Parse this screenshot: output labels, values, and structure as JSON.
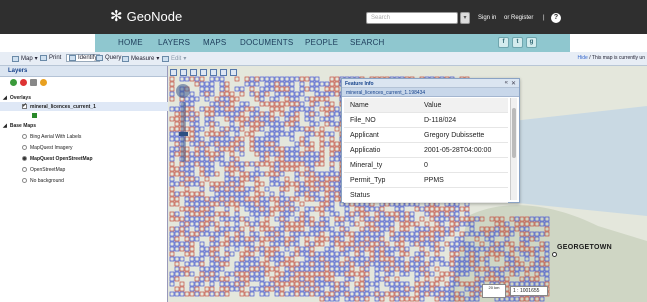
{
  "header": {
    "logo_text": "GeoNode",
    "search_placeholder": "Search",
    "sign_in": "Sign in",
    "register": "or Register",
    "separator": "|",
    "help_glyph": "?"
  },
  "nav": {
    "items": [
      "HOME",
      "LAYERS",
      "MAPS",
      "DOCUMENTS",
      "PEOPLE",
      "SEARCH"
    ],
    "social": [
      "f",
      "t",
      "g"
    ]
  },
  "toolbar": {
    "map": "Map",
    "print": "Print",
    "identify": "Identify",
    "query": "Query",
    "measure": "Measure",
    "edit": "Edit",
    "notice_link": "Hide",
    "notice_text": "This map is currently un"
  },
  "layers_panel": {
    "title": "Layers",
    "overlays_label": "Overlays",
    "overlay_layer": "mineral_licences_current_1",
    "base_maps_label": "Base Maps",
    "base_maps": [
      {
        "label": "Bing Aerial With Labels",
        "selected": false
      },
      {
        "label": "MapQuest Imagery",
        "selected": false
      },
      {
        "label": "MapQuest OpenStreetMap",
        "selected": true
      },
      {
        "label": "OpenStreetMap",
        "selected": false
      },
      {
        "label": "No background",
        "selected": false
      }
    ],
    "legend_color": "#2a8a2a"
  },
  "map": {
    "city_label": "GEORGETOWN",
    "scale_text": "20 km",
    "scale_ratio": "1 : 1001655",
    "parcel_color_red": "#c0392b",
    "parcel_color_blue": "#2c3fd0"
  },
  "feature_info": {
    "title": "Feature Info",
    "subtitle": "mineral_licences_current_1.198434",
    "header": {
      "key": "Name",
      "value": "Value"
    },
    "rows": [
      {
        "key": "File_NO",
        "value": "D-118/024"
      },
      {
        "key": "Applicant",
        "value": "Gregory Dubissette"
      },
      {
        "key": "Applicatio",
        "value": "2001-05-28T04:00:00"
      },
      {
        "key": "Mineral_ty",
        "value": "0"
      },
      {
        "key": "Permit_Typ",
        "value": "PPMS"
      },
      {
        "key": "Status",
        "value": ""
      }
    ]
  }
}
